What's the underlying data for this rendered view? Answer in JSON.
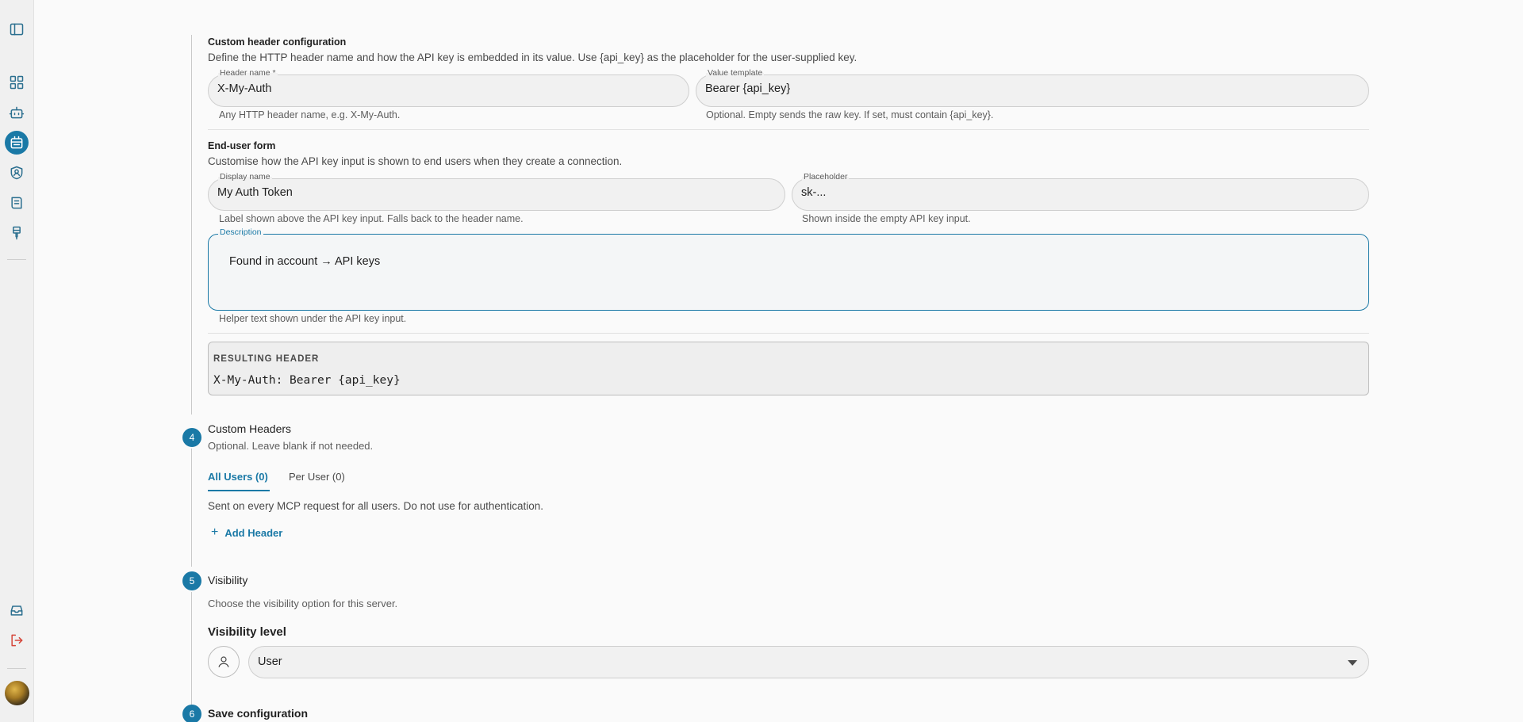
{
  "custom_header": {
    "title": "Custom header configuration",
    "description": "Define the HTTP header name and how the API key is embedded in its value. Use {api_key} as the placeholder for the user-supplied key.",
    "header_name": {
      "label": "Header name *",
      "value": "X-My-Auth",
      "helper": "Any HTTP header name, e.g. X-My-Auth."
    },
    "value_template": {
      "label": "Value template",
      "value": "Bearer {api_key}",
      "helper": "Optional. Empty sends the raw key. If set, must contain {api_key}."
    }
  },
  "end_user_form": {
    "title": "End-user form",
    "description": "Customise how the API key input is shown to end users when they create a connection.",
    "display_name": {
      "label": "Display name",
      "value": "My Auth Token",
      "helper": "Label shown above the API key input. Falls back to the header name."
    },
    "placeholder": {
      "label": "Placeholder",
      "value": "sk-...",
      "helper": "Shown inside the empty API key input."
    },
    "description_field": {
      "label": "Description",
      "value": "Found in account → API keys",
      "helper": "Helper text shown under the API key input."
    }
  },
  "resulting_header": {
    "label": "RESULTING HEADER",
    "value": "X-My-Auth: Bearer {api_key}"
  },
  "steps": {
    "custom_headers": {
      "number": "4",
      "title": "Custom Headers",
      "subtitle": "Optional. Leave blank if not needed.",
      "tabs": [
        "All Users (0)",
        "Per User (0)"
      ],
      "info": "Sent on every MCP request for all users. Do not use for authentication.",
      "add_label": "Add Header"
    },
    "visibility": {
      "number": "5",
      "title": "Visibility",
      "subtitle": "Choose the visibility option for this server.",
      "level_label": "Visibility level",
      "selected": "User"
    },
    "save": {
      "number": "6",
      "title": "Save configuration"
    }
  },
  "sidebar": {
    "icons": [
      "sidebar-toggle-icon",
      "dashboard-icon",
      "bot-icon",
      "server-icon",
      "shield-user-icon",
      "book-icon",
      "brush-icon",
      "inbox-icon",
      "logout-icon"
    ]
  },
  "colors": {
    "accent": "#1a79a6",
    "logout": "#d5463a"
  }
}
